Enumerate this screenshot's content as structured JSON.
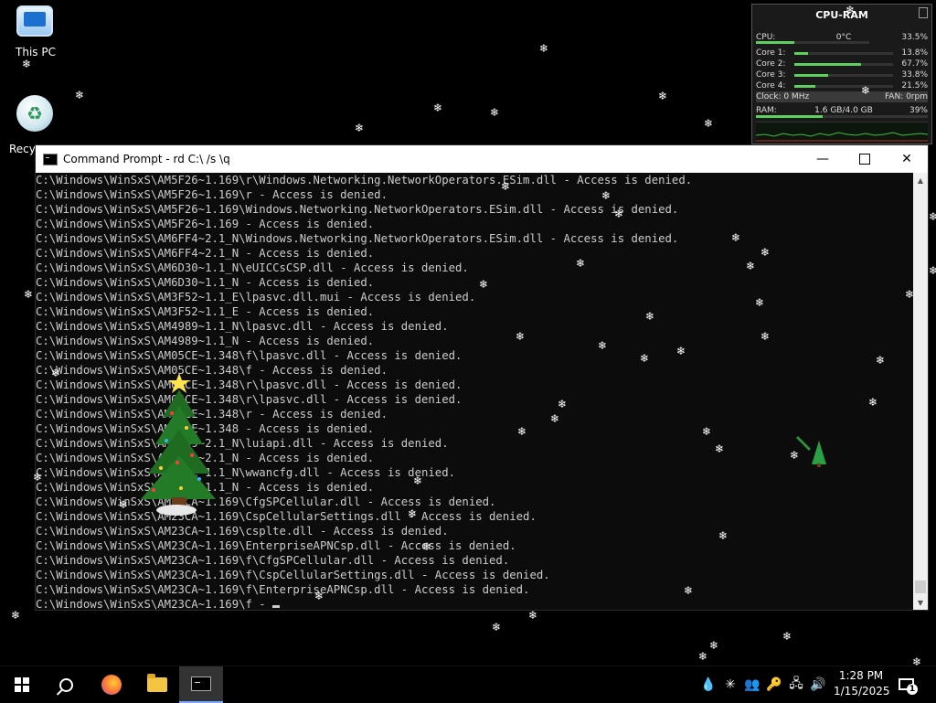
{
  "desktop": {
    "icons": [
      {
        "label": "This PC"
      },
      {
        "label": "Recyc"
      }
    ]
  },
  "gadget": {
    "title": "CPU-RAM",
    "cpu_label": "CPU:",
    "cpu_temp": "0°C",
    "cpu_value": "33.5%",
    "cpu_fraction": 0.335,
    "cores": [
      {
        "label": "Core 1:",
        "value": "13.8%",
        "fraction": 0.138
      },
      {
        "label": "Core 2:",
        "value": "67.7%",
        "fraction": 0.677
      },
      {
        "label": "Core 3:",
        "value": "33.8%",
        "fraction": 0.338
      },
      {
        "label": "Core 4:",
        "value": "21.5%",
        "fraction": 0.215
      }
    ],
    "clock_text": "Clock: 0 MHz",
    "fan_text": "FAN: 0rpm",
    "ram_label": "RAM:",
    "ram_usage": "1.6 GB/4.0 GB",
    "ram_value": "39%",
    "ram_fraction": 0.39
  },
  "cmd": {
    "title": "Command Prompt - rd  C:\\ /s \\q",
    "minimize_icon": "minimize-icon",
    "lines": [
      "C:\\Windows\\WinSxS\\AM5F26~1.169\\r\\Windows.Networking.NetworkOperators.ESim.dll - Access is denied.",
      "C:\\Windows\\WinSxS\\AM5F26~1.169\\r - Access is denied.",
      "C:\\Windows\\WinSxS\\AM5F26~1.169\\Windows.Networking.NetworkOperators.ESim.dll - Access is denied.",
      "C:\\Windows\\WinSxS\\AM5F26~1.169 - Access is denied.",
      "C:\\Windows\\WinSxS\\AM6FF4~2.1_N\\Windows.Networking.NetworkOperators.ESim.dll - Access is denied.",
      "C:\\Windows\\WinSxS\\AM6FF4~2.1_N - Access is denied.",
      "C:\\Windows\\WinSxS\\AM6D30~1.1_N\\eUICCsCSP.dll - Access is denied.",
      "C:\\Windows\\WinSxS\\AM6D30~1.1_N - Access is denied.",
      "C:\\Windows\\WinSxS\\AM3F52~1.1_E\\lpasvc.dll.mui - Access is denied.",
      "C:\\Windows\\WinSxS\\AM3F52~1.1_E - Access is denied.",
      "C:\\Windows\\WinSxS\\AM4989~1.1_N\\lpasvc.dll - Access is denied.",
      "C:\\Windows\\WinSxS\\AM4989~1.1_N - Access is denied.",
      "C:\\Windows\\WinSxS\\AM05CE~1.348\\f\\lpasvc.dll - Access is denied.",
      "C:\\Windows\\WinSxS\\AM05CE~1.348\\f - Access is denied.",
      "C:\\Windows\\WinSxS\\AM05CE~1.348\\r\\lpasvc.dll - Access is denied.",
      "C:\\Windows\\WinSxS\\AM05CE~1.348\\r\\lpasvc.dll - Access is denied.",
      "C:\\Windows\\WinSxS\\AM05CE~1.348\\r - Access is denied.",
      "C:\\Windows\\WinSxS\\AM05CE~1.348 - Access is denied.",
      "C:\\Windows\\WinSxS\\AM42D9~2.1_N\\luiapi.dll - Access is denied.",
      "C:\\Windows\\WinSxS\\AM42D9~2.1_N - Access is denied.",
      "C:\\Windows\\WinSxS\\AM1F5C~1.1_N\\wwancfg.dll - Access is denied.",
      "C:\\Windows\\WinSxS\\AM1F5C~1.1_N - Access is denied.",
      "C:\\Windows\\WinSxS\\AM23CA~1.169\\CfgSPCellular.dll - Access is denied.",
      "C:\\Windows\\WinSxS\\AM23CA~1.169\\CspCellularSettings.dll - Access is denied.",
      "C:\\Windows\\WinSxS\\AM23CA~1.169\\cspltе.dll - Access is denied.",
      "C:\\Windows\\WinSxS\\AM23CA~1.169\\EnterpriseAPNCsp.dll - Access is denied.",
      "C:\\Windows\\WinSxS\\AM23CA~1.169\\f\\CfgSPCellular.dll - Access is denied.",
      "C:\\Windows\\WinSxS\\AM23CA~1.169\\f\\CspCellularSettings.dll - Access is denied.",
      "C:\\Windows\\WinSxS\\AM23CA~1.169\\f\\EnterpriseAPNCsp.dll - Access is denied."
    ],
    "current_line": "C:\\Windows\\WinSxS\\AM23CA~1.169\\f - "
  },
  "taskbar": {
    "time": "1:28 PM",
    "date": "1/15/2025",
    "notification_count": "1"
  }
}
